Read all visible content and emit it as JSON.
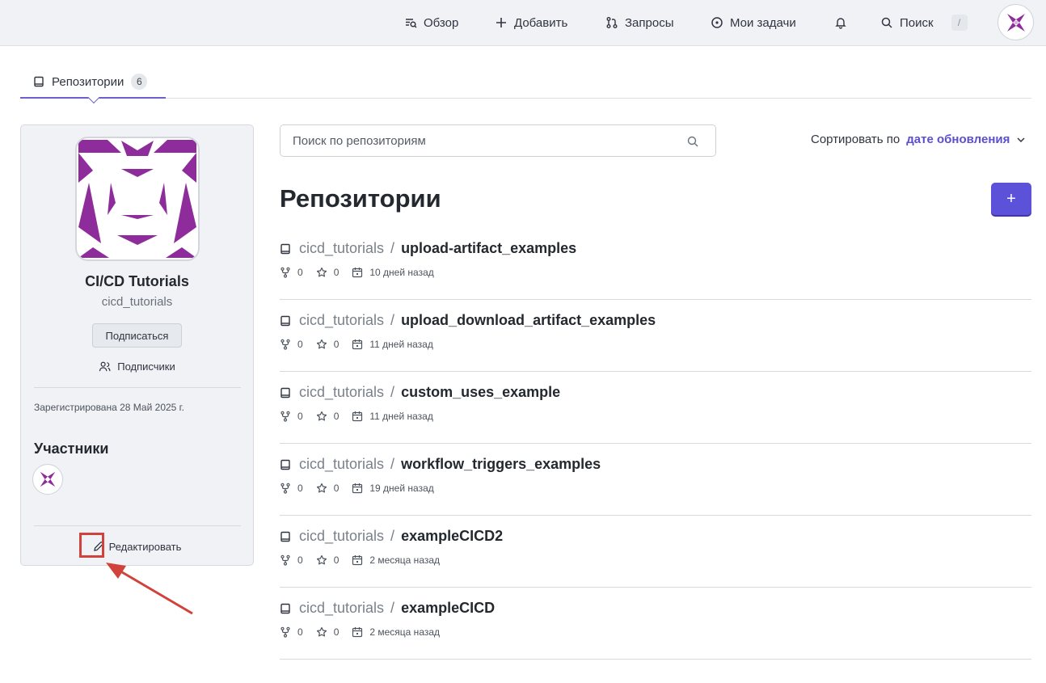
{
  "header": {
    "nav": [
      {
        "label": "Обзор",
        "icon": "explore-icon"
      },
      {
        "label": "Добавить",
        "icon": "plus-icon"
      },
      {
        "label": "Запросы",
        "icon": "pull-request-icon"
      },
      {
        "label": "Мои задачи",
        "icon": "issue-icon"
      }
    ],
    "notifications_icon": "bell-icon",
    "search_label": "Поиск",
    "search_shortcut": "/"
  },
  "tabs": [
    {
      "label": "Репозитории",
      "count": "6",
      "icon": "repo-icon"
    }
  ],
  "sidebar": {
    "org_name": "CI/CD Tutorials",
    "org_handle": "cicd_tutorials",
    "follow_label": "Подписаться",
    "followers_label": "Подписчики",
    "registered": "Зарегистрирована 28 Май 2025 г.",
    "members_title": "Участники",
    "edit_label": "Редактировать"
  },
  "main": {
    "search_placeholder": "Поиск по репозиториям",
    "sort_prefix": "Сортировать по",
    "sort_value": "дате обновления",
    "title": "Репозитории",
    "add_label": "+",
    "repos": [
      {
        "owner": "cicd_tutorials",
        "name": "upload-artifact_examples",
        "forks": "0",
        "stars": "0",
        "updated": "10 дней назад"
      },
      {
        "owner": "cicd_tutorials",
        "name": "upload_download_artifact_examples",
        "forks": "0",
        "stars": "0",
        "updated": "11 дней назад"
      },
      {
        "owner": "cicd_tutorials",
        "name": "custom_uses_example",
        "forks": "0",
        "stars": "0",
        "updated": "11 дней назад"
      },
      {
        "owner": "cicd_tutorials",
        "name": "workflow_triggers_examples",
        "forks": "0",
        "stars": "0",
        "updated": "19 дней назад"
      },
      {
        "owner": "cicd_tutorials",
        "name": "exampleCICD2",
        "forks": "0",
        "stars": "0",
        "updated": "2 месяца назад"
      },
      {
        "owner": "cicd_tutorials",
        "name": "exampleCICD",
        "forks": "0",
        "stars": "0",
        "updated": "2 месяца назад"
      }
    ]
  },
  "colors": {
    "accent": "#5b52d9",
    "brand_purple": "#8e2c9b",
    "annotation_red": "#d0423a"
  }
}
